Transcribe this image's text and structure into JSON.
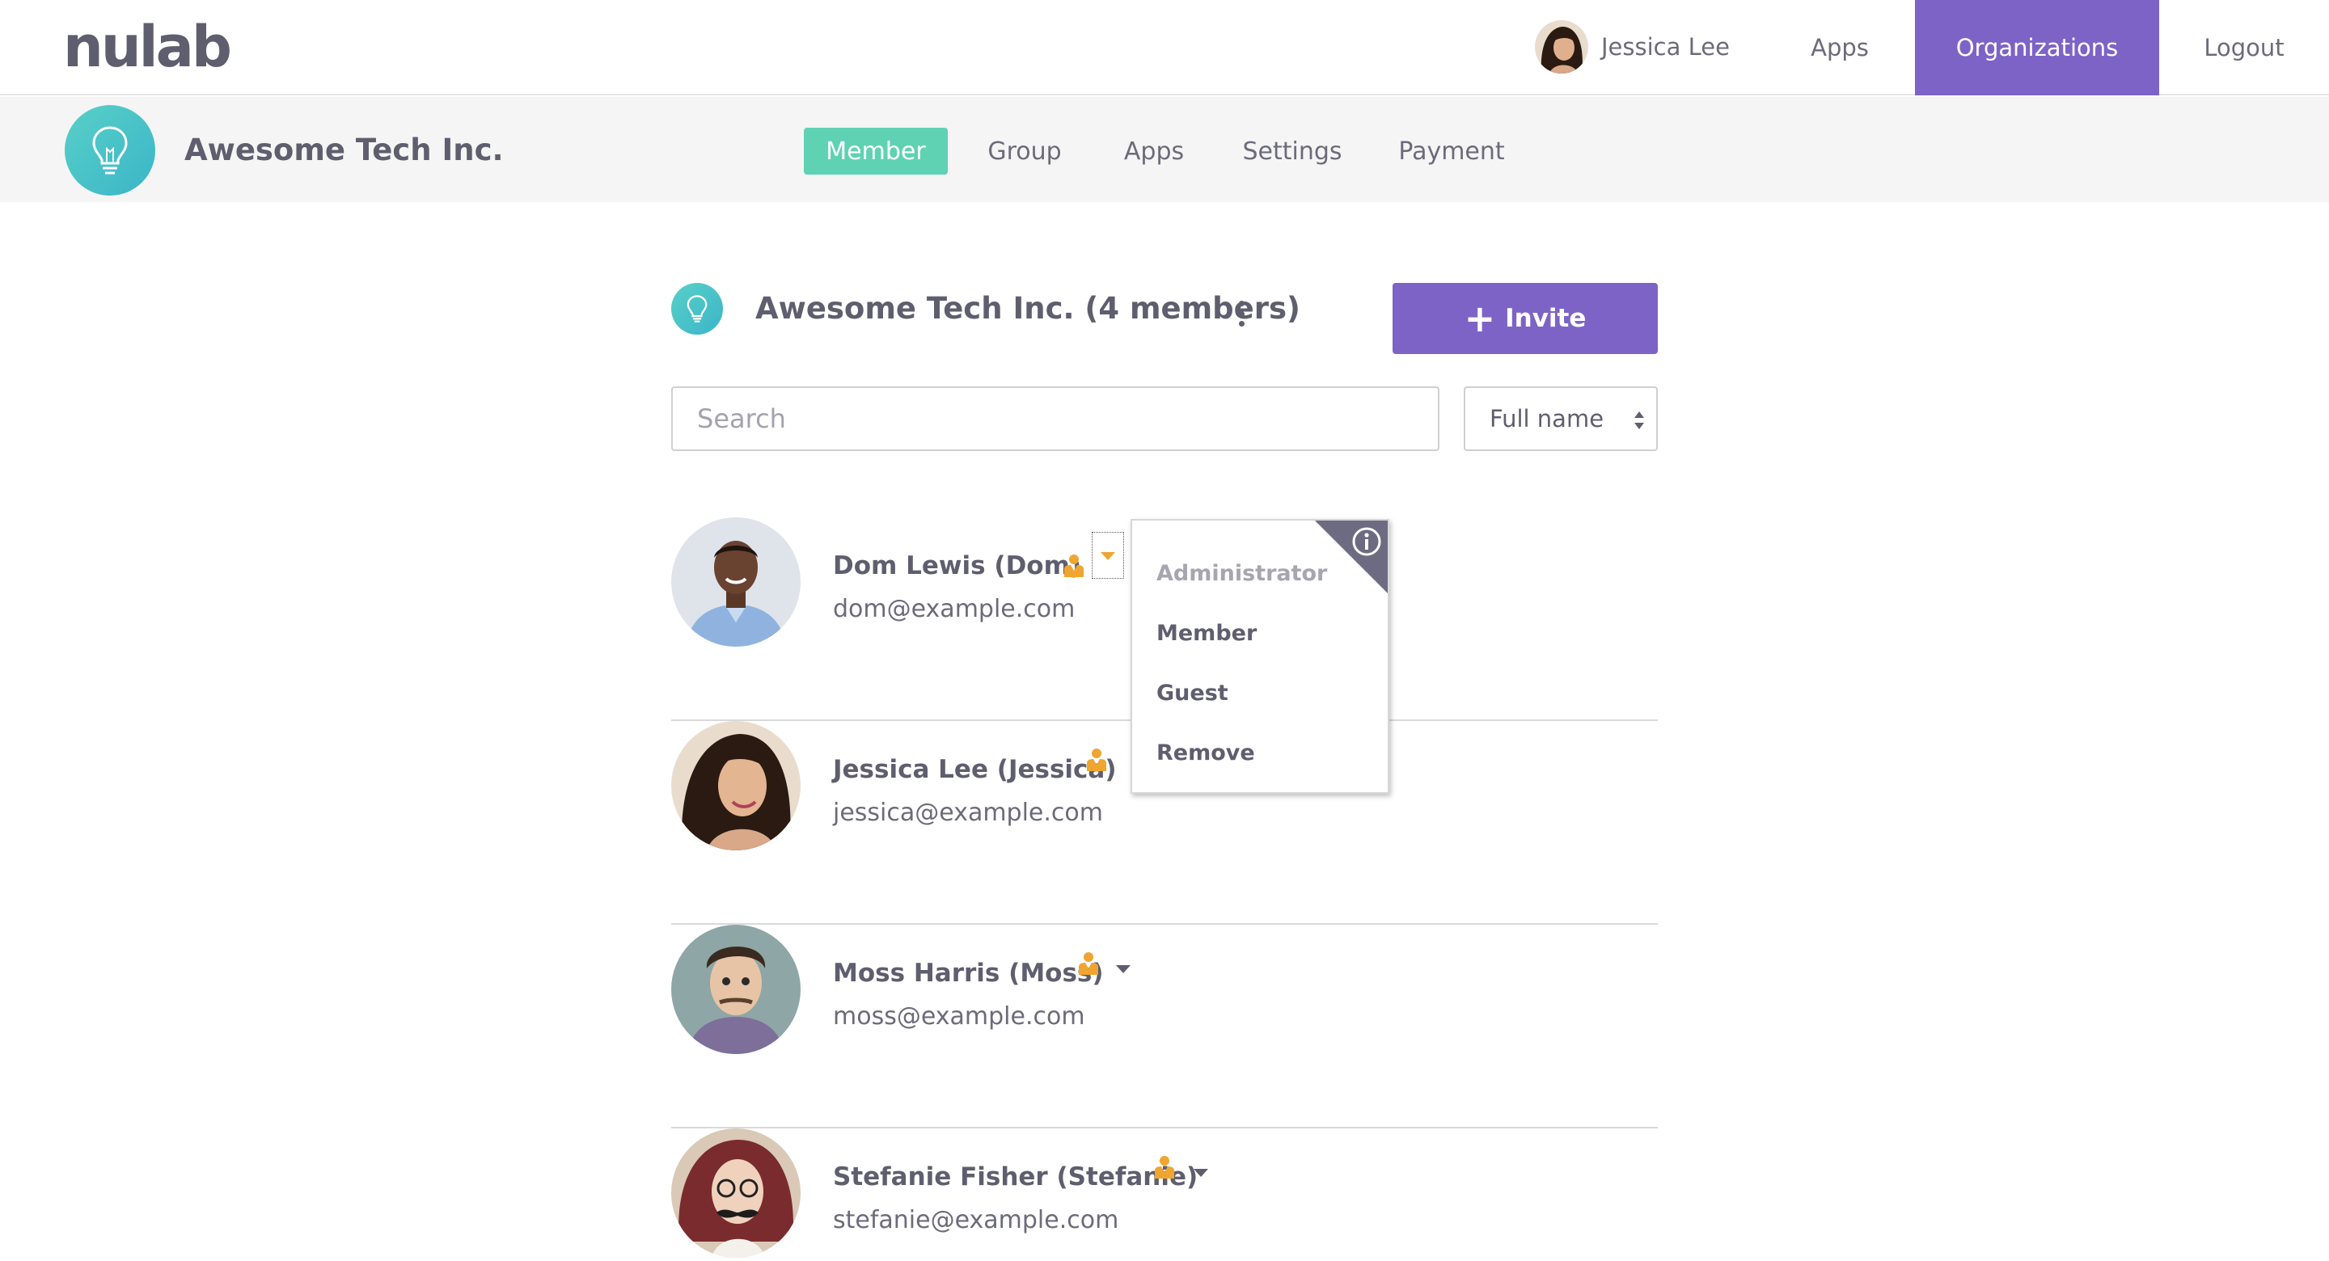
{
  "header": {
    "logo": "nulab",
    "user_name": "Jessica Lee",
    "nav": {
      "apps": "Apps",
      "organizations": "Organizations",
      "logout": "Logout"
    }
  },
  "org_bar": {
    "org_name": "Awesome Tech Inc.",
    "tabs": {
      "member": "Member",
      "group": "Group",
      "apps": "Apps",
      "settings": "Settings",
      "payment": "Payment"
    },
    "active_tab": "Member"
  },
  "main": {
    "title": "Awesome Tech Inc. (4 members)",
    "invite_label": "Invite",
    "search_placeholder": "Search",
    "sort_selected": "Full name"
  },
  "members": [
    {
      "name": "Dom Lewis (Dom)",
      "email": "dom@example.com"
    },
    {
      "name": "Jessica Lee (Jessica)",
      "email": "jessica@example.com"
    },
    {
      "name": "Moss Harris (Moss)",
      "email": "moss@example.com"
    },
    {
      "name": "Stefanie Fisher (Stefanie)",
      "email": "stefanie@example.com"
    }
  ],
  "role_menu": {
    "items": [
      "Administrator",
      "Member",
      "Guest",
      "Remove"
    ]
  },
  "colors": {
    "brand_purple": "#7e63c6",
    "active_tab_green": "#5fd2b3",
    "org_teal": "#47c3c8",
    "admin_badge_orange": "#f0a531",
    "text_dark": "#5f5e6e"
  }
}
